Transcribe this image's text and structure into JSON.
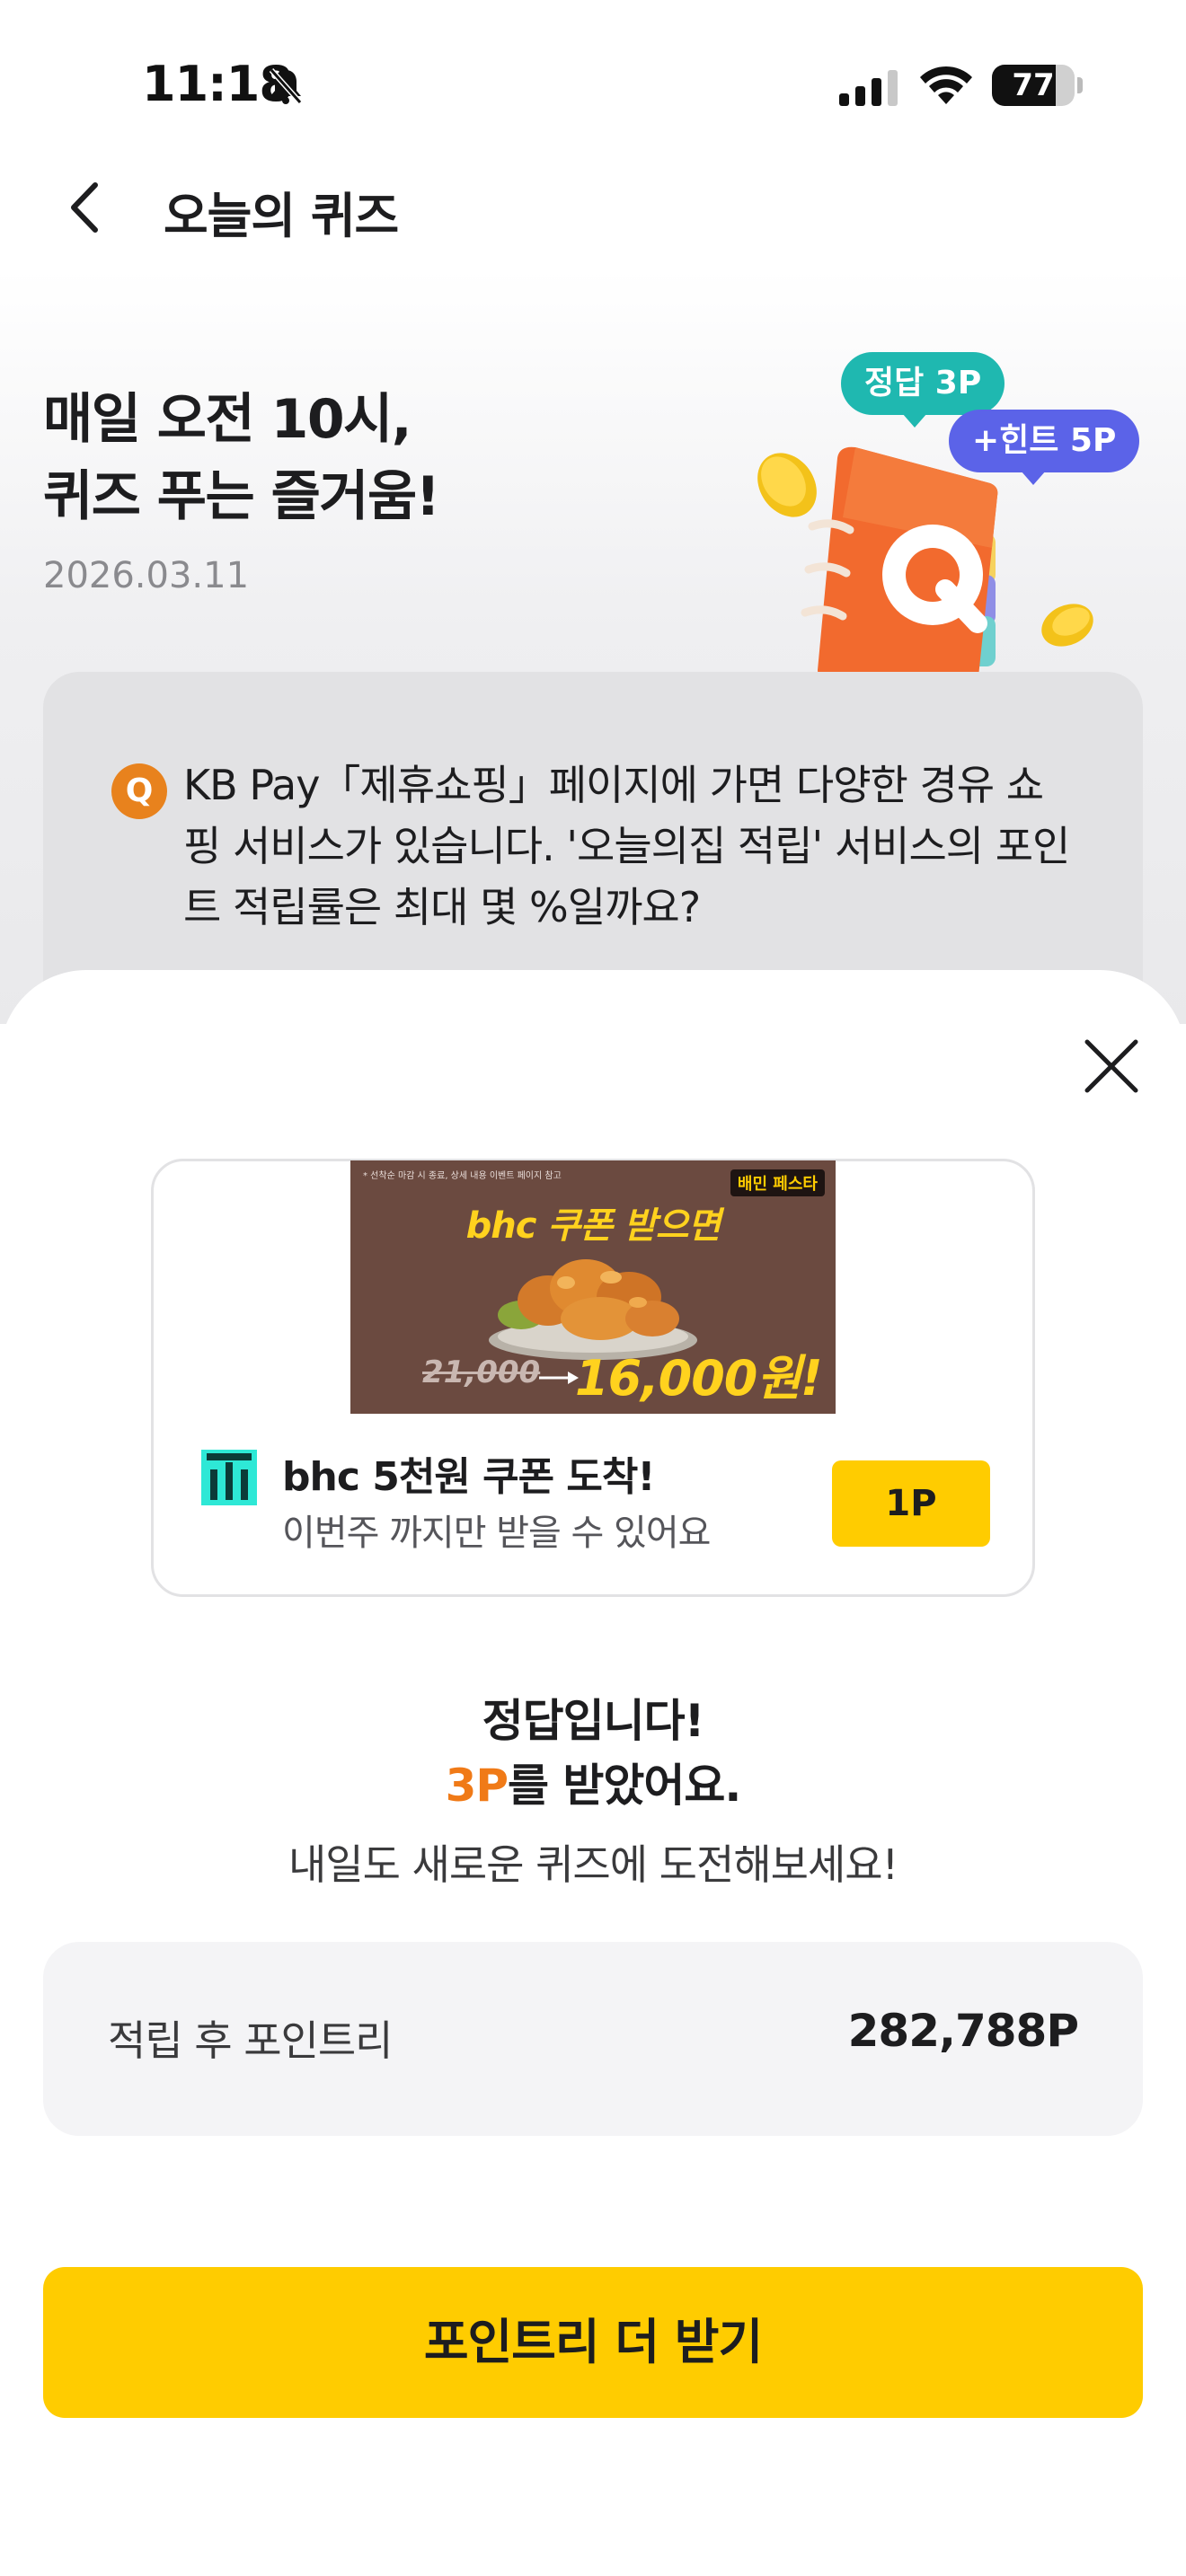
{
  "status_bar": {
    "time": "11:18",
    "battery": "77",
    "battery_level": 0.77
  },
  "nav": {
    "title": "오늘의 퀴즈"
  },
  "header": {
    "headline_line1": "매일 오전 10시,",
    "headline_line2": "퀴즈 푸는 즐거움!",
    "date": "2026.03.11",
    "badge_answer": "정답 3P",
    "badge_hint": "+힌트 5P"
  },
  "question": {
    "icon_label": "Q",
    "text": "KB Pay「제휴쇼핑」페이지에 가면 다양한 경유 쇼핑 서비스가 있습니다. '오늘의집 적립' 서비스의 포인트 적립률은 최대 몇 %일까요?"
  },
  "ad": {
    "banner_fine_print": "* 선착순 마감 시 종료, 상세 내용 이벤트 페이지 참고",
    "banner_brand": "배민 페스타",
    "banner_headline": "bhc 쿠폰 받으면",
    "banner_old_price": "21,000",
    "banner_new_price": "16,000원!",
    "title": "bhc 5천원 쿠폰 도착!",
    "subtitle": "이번주 까지만 받을 수 있어요",
    "button_label": "1P"
  },
  "result": {
    "title": "정답입니다!",
    "points_accent": "3P",
    "points_suffix": "를 받았어요.",
    "subtitle": "내일도 새로운 퀴즈에 도전해보세요!"
  },
  "balance": {
    "label": "적립 후 포인트리",
    "value": "282,788P"
  },
  "cta": {
    "label": "포인트리 더 받기"
  },
  "colors": {
    "accent_yellow": "#ffcc00",
    "accent_orange": "#f07a17",
    "badge_teal": "#1fb8b0",
    "badge_purple": "#5b63e8"
  }
}
